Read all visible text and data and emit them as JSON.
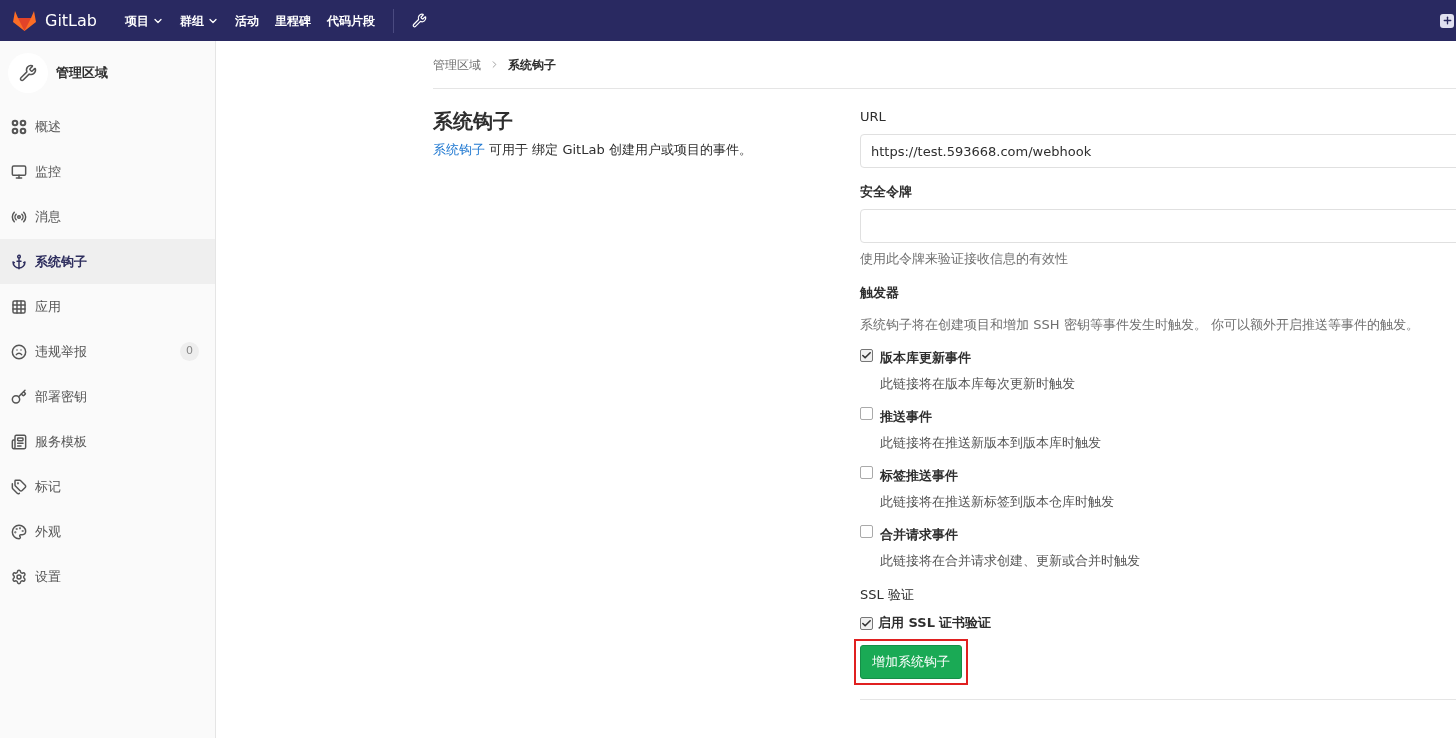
{
  "topnav": {
    "brand": "GitLab",
    "items": [
      {
        "label": "项目",
        "dropdown": true
      },
      {
        "label": "群组",
        "dropdown": true
      },
      {
        "label": "活动",
        "dropdown": false
      },
      {
        "label": "里程碑",
        "dropdown": false
      },
      {
        "label": "代码片段",
        "dropdown": false
      }
    ]
  },
  "sidebar": {
    "title": "管理区域",
    "items": [
      {
        "label": "概述",
        "selected": false
      },
      {
        "label": "监控",
        "selected": false
      },
      {
        "label": "消息",
        "selected": false
      },
      {
        "label": "系统钩子",
        "selected": true
      },
      {
        "label": "应用",
        "selected": false
      },
      {
        "label": "违规举报",
        "selected": false,
        "count": "0"
      },
      {
        "label": "部署密钥",
        "selected": false
      },
      {
        "label": "服务模板",
        "selected": false
      },
      {
        "label": "标记",
        "selected": false
      },
      {
        "label": "外观",
        "selected": false
      },
      {
        "label": "设置",
        "selected": false
      }
    ]
  },
  "breadcrumb": [
    {
      "label": "管理区域",
      "current": false
    },
    {
      "label": "系统钩子",
      "current": true
    }
  ],
  "intro": {
    "title": "系统钩子",
    "link": "系统钩子",
    "text": "可用于 绑定 GitLab 创建用户或项目的事件。"
  },
  "form": {
    "url": {
      "label": "URL",
      "value": "https://test.593668.com/webhook"
    },
    "token": {
      "label": "安全令牌",
      "help": "使用此令牌来验证接收信息的有效性"
    },
    "triggers": {
      "label": "触发器",
      "help": "系统钩子将在创建项目和增加 SSH 密钥等事件发生时触发。 你可以额外开启推送等事件的触发。",
      "items": [
        {
          "label": "版本库更新事件",
          "help": "此链接将在版本库每次更新时触发",
          "checked": true
        },
        {
          "label": "推送事件",
          "help": "此链接将在推送新版本到版本库时触发",
          "checked": false
        },
        {
          "label": "标签推送事件",
          "help": "此链接将在推送新标签到版本仓库时触发",
          "checked": false
        },
        {
          "label": "合并请求事件",
          "help": "此链接将在合并请求创建、更新或合并时触发",
          "checked": false
        }
      ]
    },
    "ssl": {
      "label": "SSL 验证",
      "option": "启用 SSL 证书验证",
      "checked": true
    },
    "submit": "增加系统钩子"
  }
}
